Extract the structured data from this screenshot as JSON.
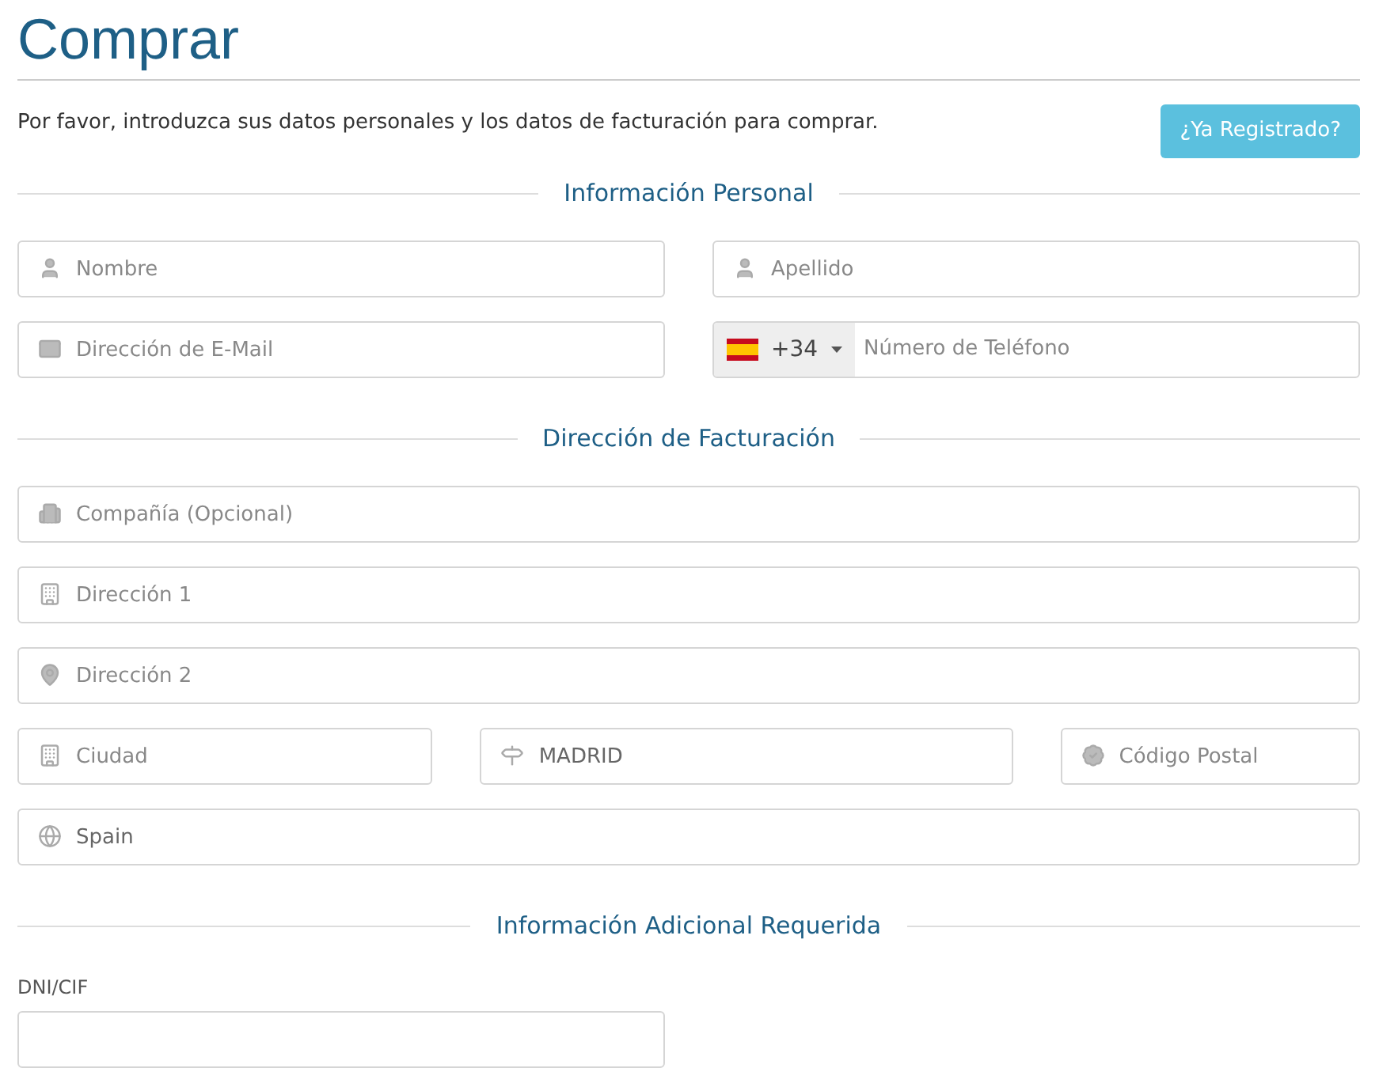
{
  "title": "Comprar",
  "intro": "Por favor, introduzca sus datos personales y los datos de facturación para comprar.",
  "login_button": "¿Ya Registrado?",
  "sections": [
    {
      "title": "Información Personal",
      "rows": [
        {
          "fields": [
            {
              "kind": "user",
              "placeholder": "Nombre"
            },
            {
              "kind": "user",
              "placeholder": "Apellido"
            }
          ]
        },
        {
          "fields": [
            {
              "kind": "mail",
              "placeholder": "Dirección de E-Mail"
            },
            {
              "kind": "phone",
              "code": "+34",
              "placeholder": "Número de Teléfono"
            }
          ]
        }
      ]
    },
    {
      "title": "Dirección de Facturación",
      "rows": [
        {
          "fields": [
            {
              "kind": "company",
              "placeholder": "Compañía (Opcional)"
            }
          ]
        },
        {
          "fields": [
            {
              "kind": "building",
              "placeholder": "Dirección 1"
            }
          ]
        },
        {
          "fields": [
            {
              "kind": "pin",
              "placeholder": "Dirección 2"
            }
          ]
        },
        {
          "fields": [
            {
              "kind": "building",
              "placeholder": "Ciudad"
            },
            {
              "kind": "sign",
              "value": "MADRID"
            },
            {
              "kind": "seal",
              "placeholder": "Código Postal"
            }
          ]
        },
        {
          "fields": [
            {
              "kind": "globe",
              "value": "Spain"
            }
          ]
        }
      ]
    },
    {
      "title": "Información Adicional Requerida",
      "rows": [
        {
          "fields": [
            {
              "kind": "plain",
              "label": "DNI/CIF"
            }
          ]
        }
      ]
    }
  ]
}
